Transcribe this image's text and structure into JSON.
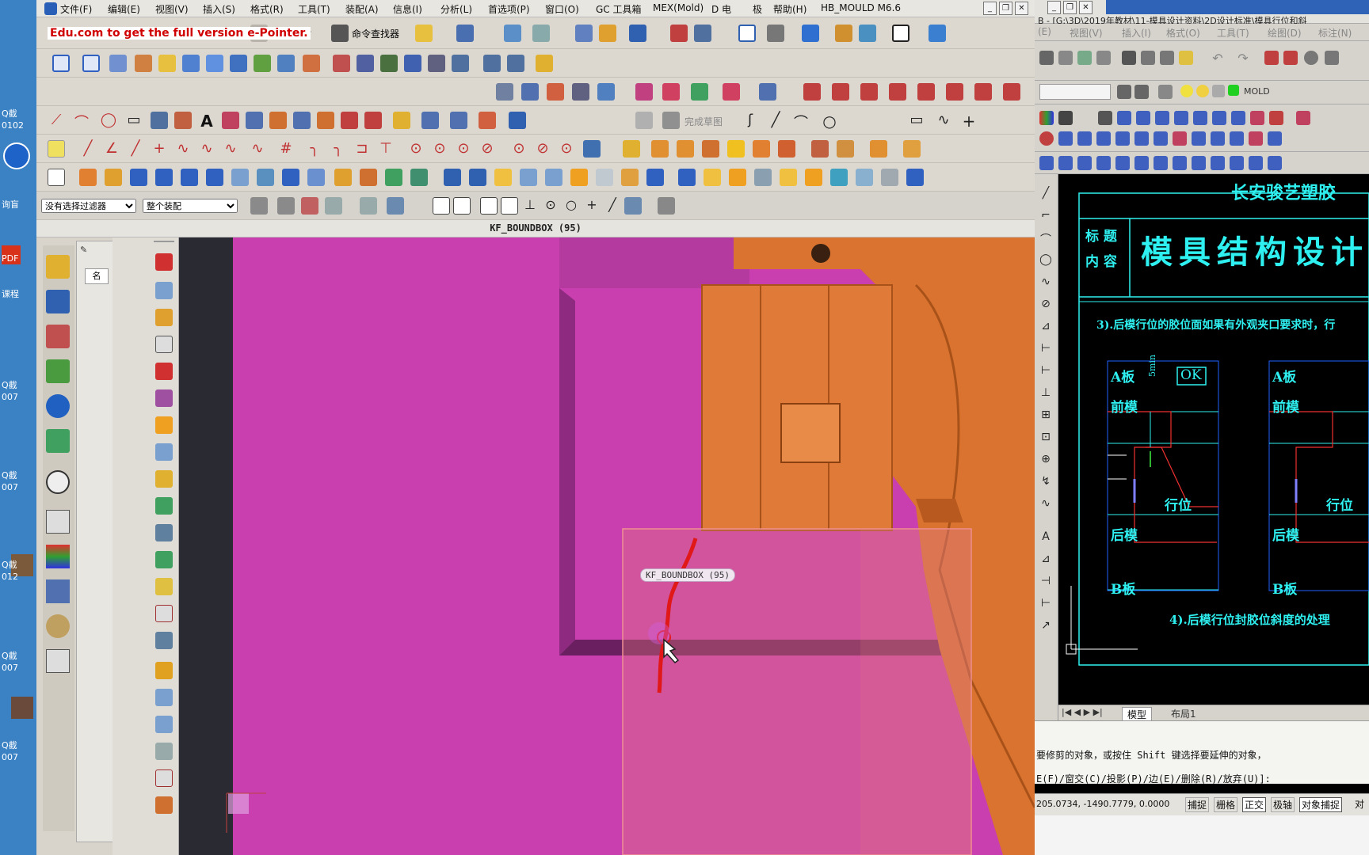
{
  "watermark": "Edu.com to get the full version e-Pointer.",
  "desktop": {
    "labels": [
      "Q截",
      "0102",
      "询盲",
      "PDF",
      "课程",
      "Q截",
      "007",
      "Q截",
      "007",
      "Q截",
      "012",
      "Q截",
      "007",
      "Q截",
      "007"
    ]
  },
  "ug": {
    "menu": [
      "文件(F)",
      "编辑(E)",
      "视图(V)",
      "插入(S)",
      "格式(R)",
      "工具(T)",
      "装配(A)",
      "信息(I)",
      "分析(L)",
      "首选项(P)",
      "窗口(O)",
      "GC 工具箱",
      "MEX(Mold)",
      "D 电",
      "极",
      "帮助(H)",
      "HB_MOULD M6.6"
    ],
    "command_finder": "命令查找器",
    "sketch_done": "完成草图",
    "filter_select": "没有选择过滤器",
    "assembly_select": "整个装配",
    "graphics_title": "KF_BOUNDBOX (95)",
    "tooltip": "KF_BOUNDBOX (95)",
    "resource_tab": "名"
  },
  "cad": {
    "title": "B - [G:\\3D\\2019年教材\\11-模具设计资料\\2D设计标准\\模具行位和斜",
    "menu": [
      "(E)",
      "视图(V)",
      "插入(I)",
      "格式(O)",
      "工具(T)",
      "绘图(D)",
      "标注(N)"
    ],
    "layer_name": "MOLD",
    "company": "长安骏艺塑胶",
    "title_label": "标 题",
    "content_label": "内 容",
    "doc_title": "模具结构设计",
    "note3": "3).后模行位的胶位面如果有外观夹口要求时，行",
    "note4": "4).后模行位封胶位斜度的处理",
    "diagram": {
      "a_plate": "A板",
      "five_min": "5min",
      "ok": "OK",
      "front_mold": "前模",
      "slide": "行位",
      "rear_mold": "后模",
      "b_plate": "B板"
    },
    "tabs": [
      "模型",
      "布局1"
    ],
    "cmd_line1": "要修剪的对象，或按住 Shift 键选择要延伸的对象，",
    "cmd_line2": "E(F)/窗交(C)/投影(P)/边(E)/删除(R)/放弃(U)]:",
    "coords": "205.0734, -1490.7779, 0.0000",
    "status_buttons": [
      "捕捉",
      "栅格",
      "正交",
      "极轴",
      "对象捕捉",
      "对"
    ]
  },
  "colors": {
    "viewport_magenta": "#c93fb0",
    "part_orange": "#e07a38",
    "cad_cyan": "#2ff0f0"
  }
}
